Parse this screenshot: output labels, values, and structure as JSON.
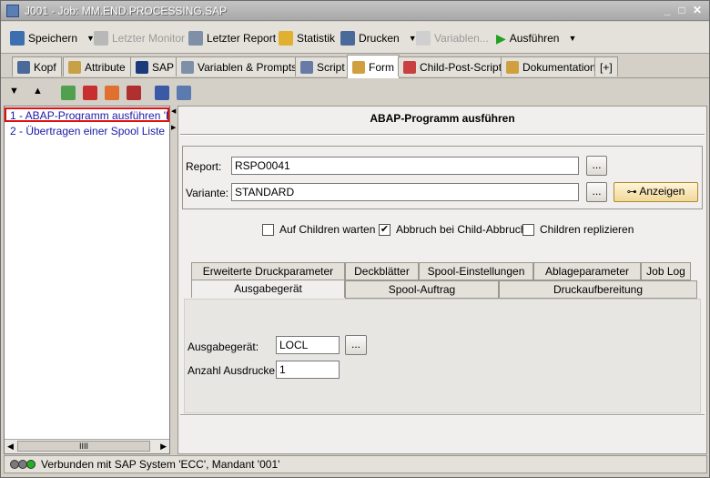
{
  "window": {
    "title": "J001 - Job: MM.END.PROCESSING.SAP"
  },
  "toolbar": {
    "speichern": "Speichern",
    "letzter_monitor": "Letzter Monitor",
    "letzter_report": "Letzter Report",
    "statistik": "Statistik",
    "drucken": "Drucken",
    "variablen": "Variablen...",
    "ausfuehren": "Ausführen"
  },
  "tabs": [
    "Kopf",
    "Attribute",
    "SAP",
    "Variablen & Prompts",
    "Script",
    "Form",
    "Child-Post-Script",
    "Dokumentation",
    "[+]"
  ],
  "tree": {
    "items": [
      "1 - ABAP-Programm ausführen 'RSPO0041'",
      "2 - Übertragen einer Spool Liste"
    ],
    "scroll_label": "IIII"
  },
  "form": {
    "heading": "ABAP-Programm ausführen",
    "report_label": "Report:",
    "report_value": "RSPO0041",
    "variante_label": "Variante:",
    "variante_value": "STANDARD",
    "browse": "...",
    "anzeigen": "Anzeigen",
    "checkboxes": {
      "wait": {
        "label": "Auf Children warten",
        "checked": false
      },
      "abort": {
        "label": "Abbruch bei Child-Abbruch",
        "checked": true
      },
      "replicate": {
        "label": "Children replizieren",
        "checked": false
      }
    },
    "subtabs_row1": [
      "Erweiterte Druckparameter",
      "Deckblätter",
      "Spool-Einstellungen",
      "Ablageparameter",
      "Job Log"
    ],
    "subtabs_row2": [
      "Ausgabegerät",
      "Spool-Auftrag",
      "Druckaufbereitung"
    ],
    "ausgabegeraet_label": "Ausgabegerät:",
    "ausgabegeraet_value": "LOCL",
    "anzahl_label": "Anzahl Ausdrucke:",
    "anzahl_value": "1"
  },
  "status": {
    "text": "Verbunden mit SAP System 'ECC', Mandant '001'"
  },
  "colors": {
    "accent": "#1a1aa8",
    "selection_border": "#e01010",
    "status_green": "#22b022"
  }
}
